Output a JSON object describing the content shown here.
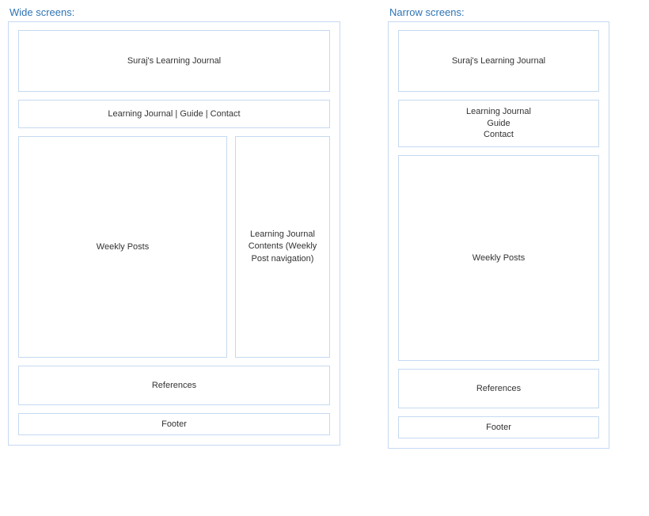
{
  "wide": {
    "heading": "Wide screens:",
    "header": "Suraj's Learning Journal",
    "nav": "Learning Journal | Guide | Contact",
    "posts": "Weekly Posts",
    "sidebar": "Learning Journal Contents (Weekly Post navigation)",
    "references": "References",
    "footer": "Footer"
  },
  "narrow": {
    "heading": "Narrow screens:",
    "header": "Suraj's Learning Journal",
    "nav_line1": "Learning Journal",
    "nav_line2": "Guide",
    "nav_line3": "Contact",
    "posts": "Weekly Posts",
    "references": "References",
    "footer": "Footer"
  }
}
